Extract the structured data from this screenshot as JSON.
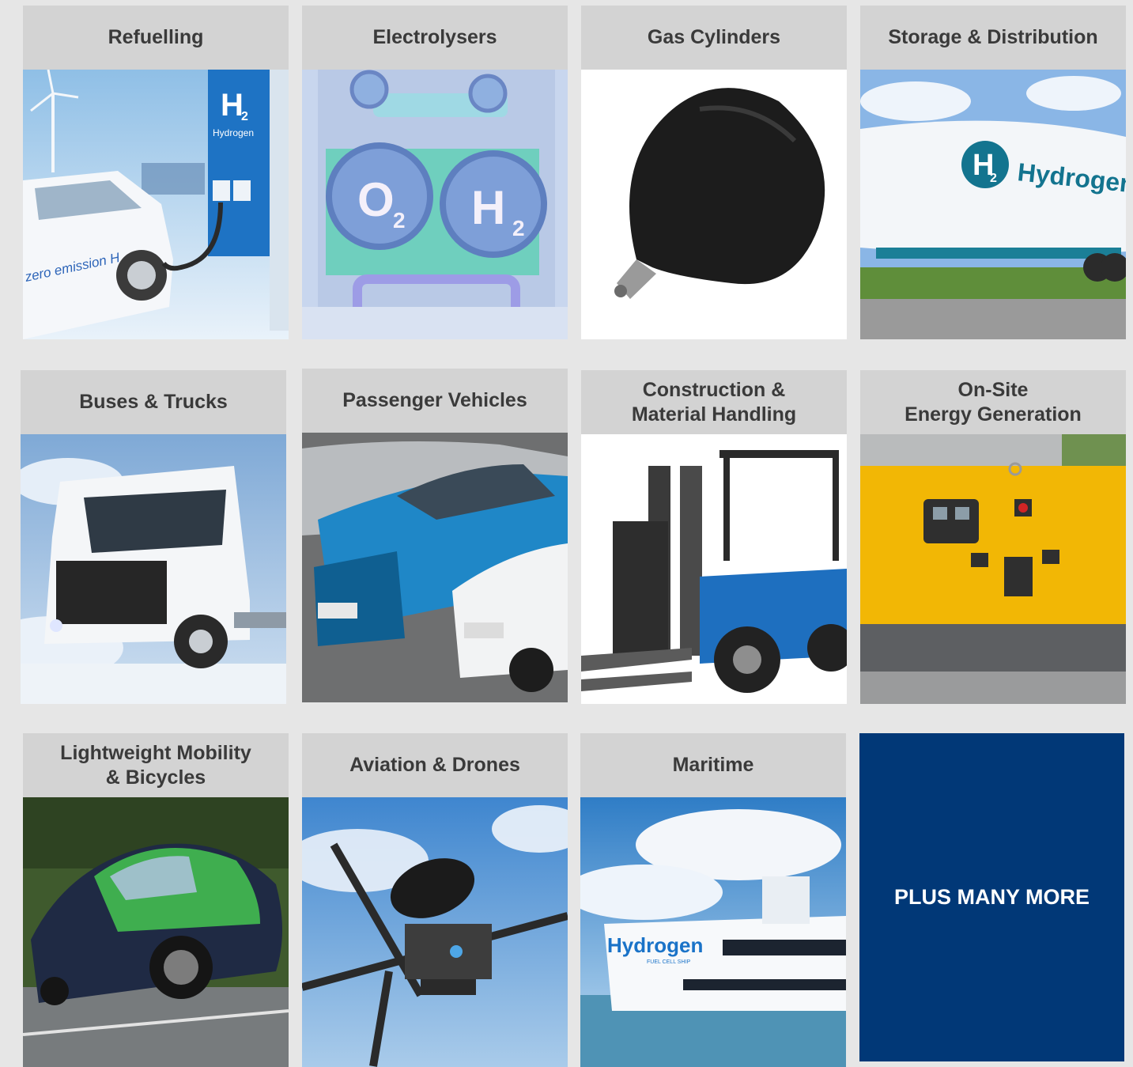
{
  "tiles": [
    {
      "title": "Refuelling",
      "icon": "hydrogen-refuelling-station-image",
      "labels": [
        "H",
        "2",
        "Hydrogen",
        "zero emission H"
      ]
    },
    {
      "title": "Electrolysers",
      "icon": "electrolyser-image",
      "labels": [
        "O",
        "2",
        "H",
        "2"
      ]
    },
    {
      "title": "Gas Cylinders",
      "icon": "gas-cylinder-image",
      "labels": []
    },
    {
      "title": "Storage & Distribution",
      "icon": "hydrogen-tanker-trailer-image",
      "labels": [
        "H",
        "2",
        "Hydrogen"
      ]
    },
    {
      "title": "Buses & Trucks",
      "icon": "hydrogen-truck-image",
      "labels": []
    },
    {
      "title": "Passenger Vehicles",
      "icon": "parked-cars-image",
      "labels": []
    },
    {
      "title": "Construction &\nMaterial Handling",
      "icon": "forklift-image",
      "labels": []
    },
    {
      "title": "On-Site\nEnergy Generation",
      "icon": "generator-image",
      "labels": []
    },
    {
      "title": "Lightweight Mobility\n& Bicycles",
      "icon": "eco-racing-car-image",
      "labels": []
    },
    {
      "title": "Aviation & Drones",
      "icon": "hydrogen-drone-image",
      "labels": []
    },
    {
      "title": "Maritime",
      "icon": "hydrogen-ship-image",
      "labels": [
        "Hydrogen",
        "FUEL CELL SHIP"
      ]
    }
  ],
  "more": {
    "label": "PLUS MANY MORE"
  },
  "colors": {
    "header_bg": "#d3d3d3",
    "page_bg": "#e6e6e6",
    "accent": "#013877",
    "header_text": "#3a3a3a"
  }
}
